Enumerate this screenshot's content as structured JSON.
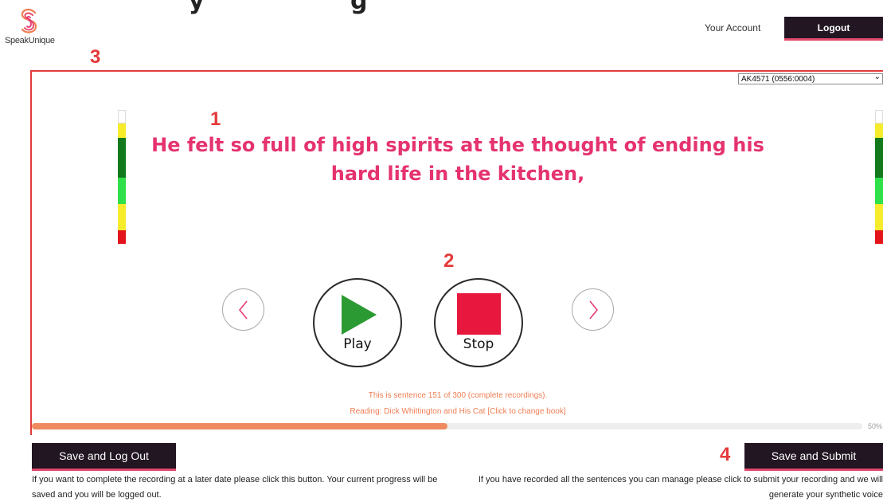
{
  "brand": {
    "name": "SpeakUnique",
    "colors": {
      "primary_dark": "#221622",
      "accent_pink": "#e5336f",
      "annotation_red": "#e43a3a",
      "info_orange": "#f07f55",
      "play_green": "#2c9a33",
      "stop_red": "#e8173e"
    }
  },
  "header": {
    "cut_heading_left": "y",
    "cut_heading_right": "g",
    "your_account": "Your Account",
    "logout": "Logout"
  },
  "annotations": {
    "n1": "1",
    "n2": "2",
    "n3": "3",
    "n4": "4"
  },
  "recorder": {
    "speaker_select": {
      "selected": "AK4571 (0556:0004)"
    },
    "sentence": "He felt so full of high spirits at the thought of ending his hard life in the kitchen,",
    "controls": {
      "prev_icon": "chevron-left-icon",
      "play_label": "Play",
      "stop_label": "Stop",
      "next_icon": "chevron-right-icon"
    },
    "sentence_status": "This is sentence 151 of 300 (complete recordings).",
    "reading": "Reading: Dick Whittington and His Cat [Click to change book]",
    "progress": {
      "fraction": 0.5,
      "label": "50%"
    }
  },
  "level_meter": {
    "segments": [
      "#ffffff",
      "#f7ec2c",
      "#127a1d",
      "#2fe04a",
      "#f7ec2c",
      "#e3141c"
    ]
  },
  "footer": {
    "save_logout": "Save and Log Out",
    "save_logout_help": "If you want to complete the recording at a later date please click this button. Your current progress will be saved and you will be logged out.",
    "save_submit": "Save and Submit",
    "save_submit_help": "If you have recorded all the sentences you can manage please click to submit your recording and we will generate your synthetic voice"
  }
}
